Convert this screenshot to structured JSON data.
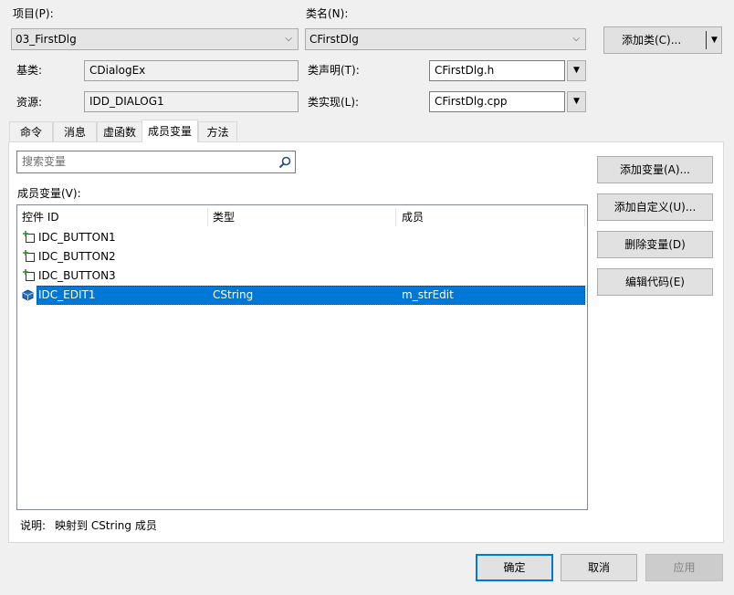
{
  "labels": {
    "project": "项目(P):",
    "class_name": "类名(N):",
    "base_class": "基类:",
    "resource": "资源:",
    "class_decl": "类声明(T):",
    "class_impl": "类实现(L):",
    "search_placeholder": "搜索变量",
    "member_vars": "成员变量(V):",
    "description_label": "说明:",
    "description_text": "映射到 CString 成员"
  },
  "values": {
    "project": "03_FirstDlg",
    "class_name": "CFirstDlg",
    "base_class": "CDialogEx",
    "resource": "IDD_DIALOG1",
    "class_decl": "CFirstDlg.h",
    "class_impl": "CFirstDlg.cpp"
  },
  "buttons": {
    "add_class": "添加类(C)...",
    "add_variable": "添加变量(A)...",
    "add_custom": "添加自定义(U)...",
    "delete_variable": "删除变量(D)",
    "edit_code": "编辑代码(E)",
    "ok": "确定",
    "cancel": "取消",
    "apply": "应用"
  },
  "tabs": [
    "命令",
    "消息",
    "虚函数",
    "成员变量",
    "方法"
  ],
  "active_tab": "成员变量",
  "table": {
    "columns": [
      "控件 ID",
      "类型",
      "成员"
    ],
    "rows": [
      {
        "id": "IDC_BUTTON1",
        "type": "",
        "member": "",
        "icon": "button-control-icon"
      },
      {
        "id": "IDC_BUTTON2",
        "type": "",
        "member": "",
        "icon": "button-control-icon"
      },
      {
        "id": "IDC_BUTTON3",
        "type": "",
        "member": "",
        "icon": "button-control-icon"
      },
      {
        "id": "IDC_EDIT1",
        "type": "CString",
        "member": "m_strEdit",
        "icon": "variable-icon",
        "selected": true
      }
    ]
  },
  "colors": {
    "selection": "#0078d7",
    "default_button_border": "#0078d7"
  }
}
